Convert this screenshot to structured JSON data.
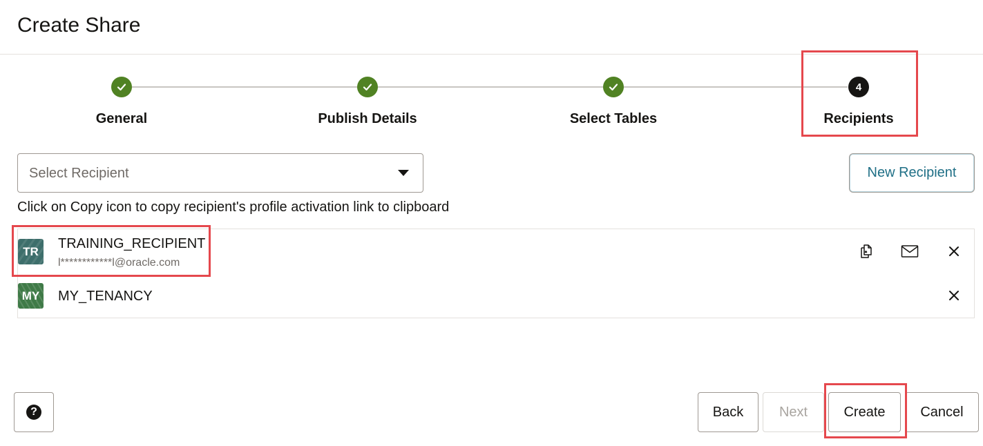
{
  "dialog": {
    "title": "Create Share"
  },
  "stepper": {
    "steps": [
      {
        "label": "General",
        "state": "complete"
      },
      {
        "label": "Publish Details",
        "state": "complete"
      },
      {
        "label": "Select Tables",
        "state": "complete"
      },
      {
        "label": "Recipients",
        "state": "current",
        "number": "4"
      }
    ]
  },
  "recipient_select": {
    "placeholder": "Select Recipient"
  },
  "new_recipient_label": "New Recipient",
  "hint": "Click on Copy icon to copy recipient's profile activation link to clipboard",
  "recipients": [
    {
      "initials": "TR",
      "name": "TRAINING_RECIPIENT",
      "email": "l************l@oracle.com"
    },
    {
      "initials": "MY",
      "name": "MY_TENANCY"
    }
  ],
  "footer": {
    "back": "Back",
    "next": "Next",
    "create": "Create",
    "cancel": "Cancel",
    "help": "?"
  },
  "colors": {
    "accent": "#1f6f86",
    "complete": "#508223",
    "highlight": "#e5484d"
  }
}
